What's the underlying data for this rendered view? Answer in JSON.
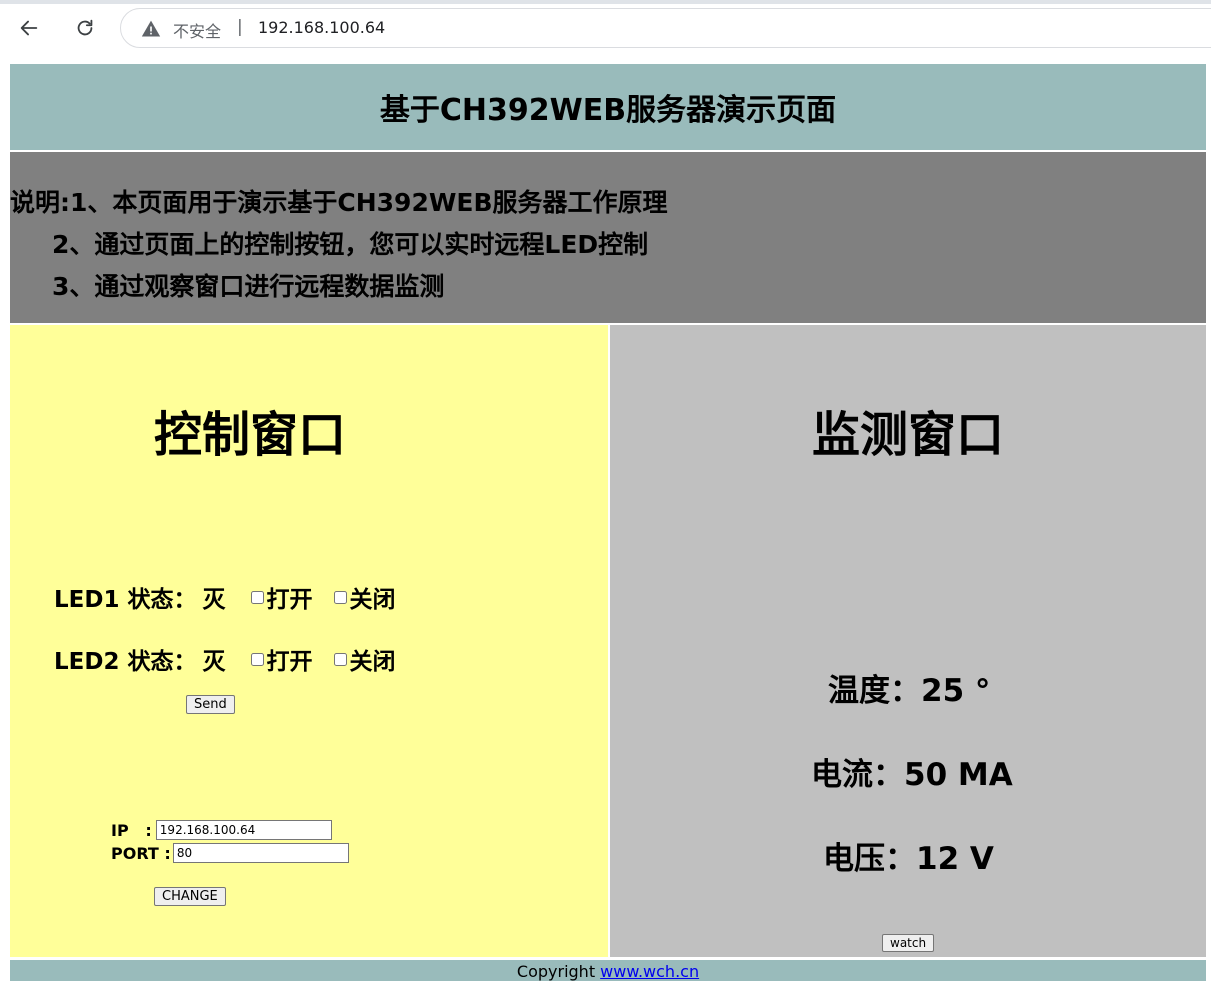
{
  "browser": {
    "security_label": "不安全",
    "separator": "|",
    "url": "192.168.100.64"
  },
  "page": {
    "title": "基于CH392WEB服务器演示页面",
    "description": [
      "说明:1、本页面用于演示基于CH392WEB服务器工作原理",
      "2、通过页面上的控制按钮，您可以实时远程LED控制",
      "3、通过观察窗口进行远程数据监测"
    ]
  },
  "control": {
    "title": "控制窗口",
    "leds": [
      {
        "label": "LED1 状态：",
        "state": "灭",
        "on_label": "打开",
        "off_label": "关闭"
      },
      {
        "label": "LED2 状态：",
        "state": "灭",
        "on_label": "打开",
        "off_label": "关闭"
      }
    ],
    "send_label": "Send",
    "ip_label": "IP   :",
    "ip_value": "192.168.100.64",
    "port_label": "PORT :",
    "port_value": "80",
    "change_label": "CHANGE"
  },
  "monitor": {
    "title": "监测窗口",
    "temperature": "温度：25 °",
    "current": "电流：50 MA",
    "voltage": "电压：12 V",
    "watch_label": "watch"
  },
  "footer": {
    "text": "Copyright ",
    "link": "www.wch.cn"
  }
}
